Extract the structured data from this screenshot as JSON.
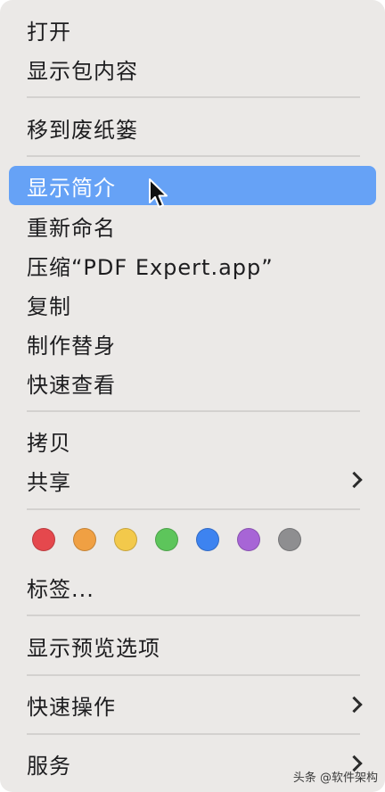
{
  "menu": {
    "items": [
      {
        "label": "打开"
      },
      {
        "label": "显示包内容"
      },
      {
        "label": "移到废纸篓"
      },
      {
        "label": "显示简介"
      },
      {
        "label": "重新命名"
      },
      {
        "label": "压缩“PDF Expert.app”"
      },
      {
        "label": "复制"
      },
      {
        "label": "制作替身"
      },
      {
        "label": "快速查看"
      },
      {
        "label": "拷贝"
      },
      {
        "label": "共享"
      },
      {
        "label": "标签..."
      },
      {
        "label": "显示预览选项"
      },
      {
        "label": "快速操作"
      },
      {
        "label": "服务"
      }
    ],
    "highlight_color": "#66a2f6",
    "tag_colors": [
      "#e5484d",
      "#f0a043",
      "#f3c94b",
      "#5dc55b",
      "#3d83f0",
      "#a765d6",
      "#8e8e90"
    ]
  },
  "watermark": "头条 @软件架构"
}
